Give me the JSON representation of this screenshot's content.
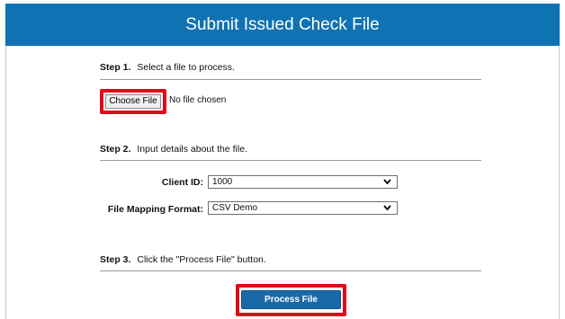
{
  "header": {
    "title": "Submit Issued Check File"
  },
  "step1": {
    "label": "Step 1.",
    "text": "Select a file to process.",
    "choose_button": "Choose File",
    "file_status": "No file chosen"
  },
  "step2": {
    "label": "Step 2.",
    "text": "Input details about the file.",
    "client_id_label": "Client ID:",
    "client_id_value": "1000",
    "mapping_label": "File Mapping Format:",
    "mapping_value": "CSV Demo"
  },
  "step3": {
    "label": "Step 3.",
    "text": "Click the \"Process File\" button.",
    "process_button": "Process File"
  },
  "colors": {
    "header_bg": "#0f72b3",
    "highlight": "#e0091a",
    "button_bg": "#1b6aa8"
  },
  "icons": {
    "dropdown": "chevron-down-icon"
  }
}
